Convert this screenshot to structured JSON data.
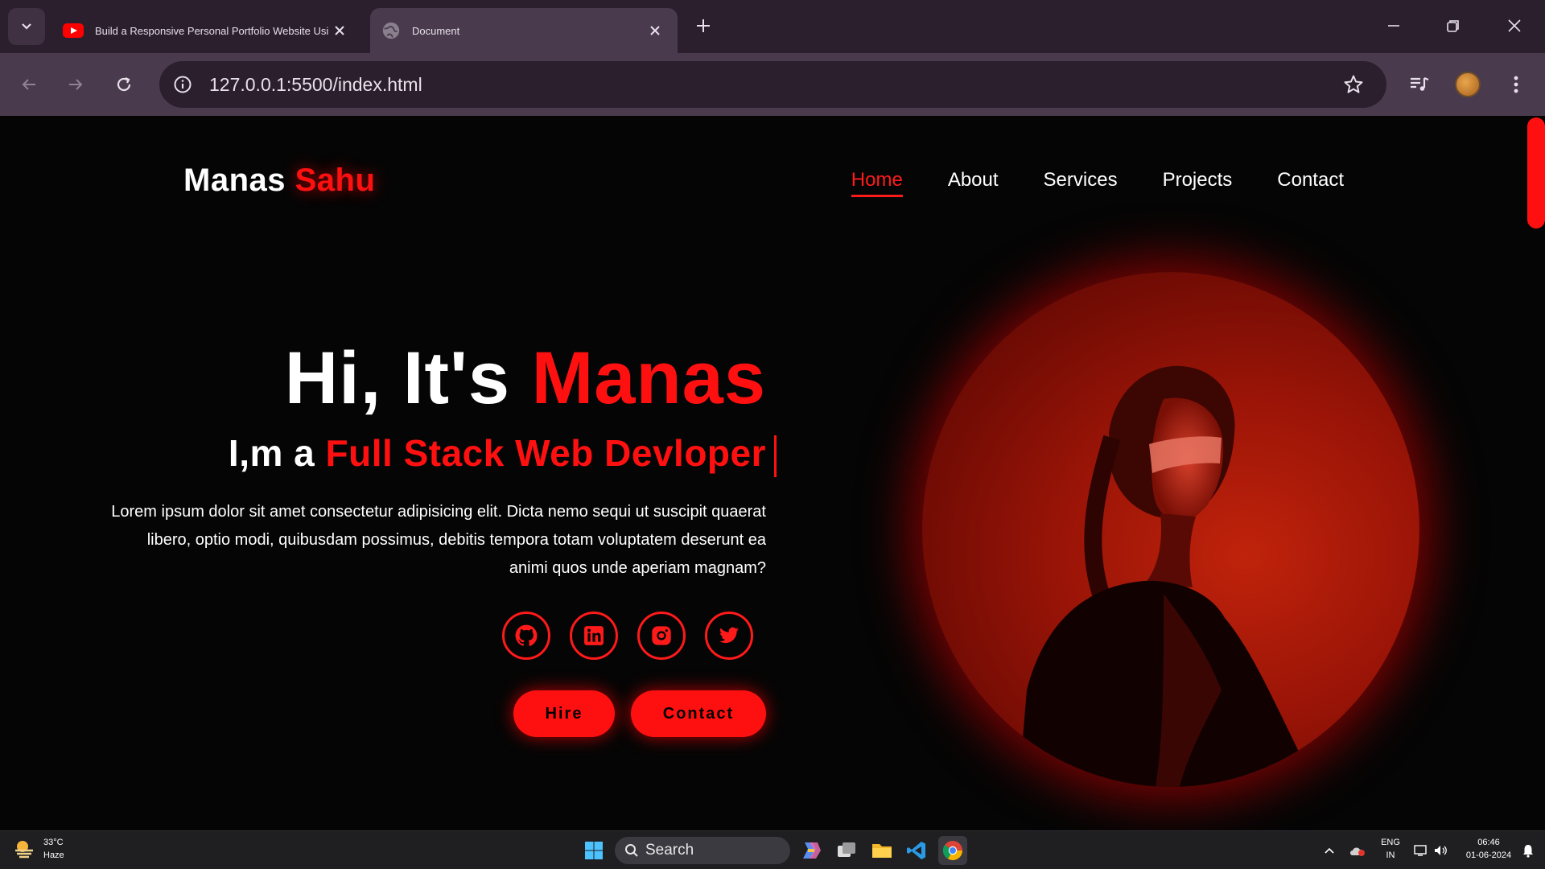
{
  "browser": {
    "tabs": [
      {
        "title": "Build a Responsive Personal Portfolio Website Using HTML CSS",
        "active": false,
        "favicon": "youtube-icon"
      },
      {
        "title": "Document",
        "active": true,
        "favicon": "globe-icon"
      }
    ],
    "url": "127.0.0.1:5500/index.html"
  },
  "site": {
    "logo": {
      "first": "Manas ",
      "last": "Sahu"
    },
    "nav": [
      "Home",
      "About",
      "Services",
      "Projects",
      "Contact"
    ],
    "active_nav": "Home",
    "hero": {
      "greeting_prefix": "Hi, It's ",
      "greeting_name": "Manas",
      "role_prefix": "I,m a ",
      "role": "Full Stack Web Devloper",
      "description": "Lorem ipsum dolor sit amet consectetur adipisicing elit. Dicta nemo sequi ut suscipit quaerat libero, optio modi, quibusdam possimus, debitis tempora totam voluptatem deserunt ea animi quos unde aperiam magnam?",
      "socials": [
        "github-icon",
        "linkedin-icon",
        "instagram-icon",
        "twitter-icon"
      ],
      "buttons": {
        "hire": "Hire",
        "contact": "Contact"
      }
    },
    "colors": {
      "accent": "#ff1010",
      "background": "#050505"
    }
  },
  "taskbar": {
    "weather": {
      "temp": "33°C",
      "condition": "Haze"
    },
    "search_label": "Search",
    "lang": {
      "line1": "ENG",
      "line2": "IN"
    },
    "clock": {
      "time": "06:46",
      "date": "01-06-2024"
    }
  }
}
